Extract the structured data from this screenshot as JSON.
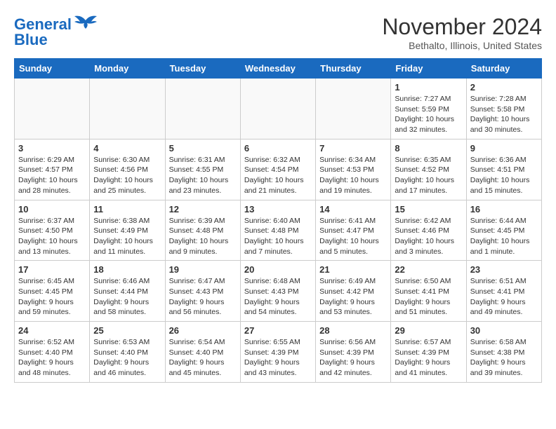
{
  "logo": {
    "line1": "General",
    "line2": "Blue"
  },
  "title": "November 2024",
  "location": "Bethalto, Illinois, United States",
  "days_of_week": [
    "Sunday",
    "Monday",
    "Tuesday",
    "Wednesday",
    "Thursday",
    "Friday",
    "Saturday"
  ],
  "weeks": [
    [
      {
        "day": "",
        "info": ""
      },
      {
        "day": "",
        "info": ""
      },
      {
        "day": "",
        "info": ""
      },
      {
        "day": "",
        "info": ""
      },
      {
        "day": "",
        "info": ""
      },
      {
        "day": "1",
        "info": "Sunrise: 7:27 AM\nSunset: 5:59 PM\nDaylight: 10 hours and 32 minutes."
      },
      {
        "day": "2",
        "info": "Sunrise: 7:28 AM\nSunset: 5:58 PM\nDaylight: 10 hours and 30 minutes."
      }
    ],
    [
      {
        "day": "3",
        "info": "Sunrise: 6:29 AM\nSunset: 4:57 PM\nDaylight: 10 hours and 28 minutes."
      },
      {
        "day": "4",
        "info": "Sunrise: 6:30 AM\nSunset: 4:56 PM\nDaylight: 10 hours and 25 minutes."
      },
      {
        "day": "5",
        "info": "Sunrise: 6:31 AM\nSunset: 4:55 PM\nDaylight: 10 hours and 23 minutes."
      },
      {
        "day": "6",
        "info": "Sunrise: 6:32 AM\nSunset: 4:54 PM\nDaylight: 10 hours and 21 minutes."
      },
      {
        "day": "7",
        "info": "Sunrise: 6:34 AM\nSunset: 4:53 PM\nDaylight: 10 hours and 19 minutes."
      },
      {
        "day": "8",
        "info": "Sunrise: 6:35 AM\nSunset: 4:52 PM\nDaylight: 10 hours and 17 minutes."
      },
      {
        "day": "9",
        "info": "Sunrise: 6:36 AM\nSunset: 4:51 PM\nDaylight: 10 hours and 15 minutes."
      }
    ],
    [
      {
        "day": "10",
        "info": "Sunrise: 6:37 AM\nSunset: 4:50 PM\nDaylight: 10 hours and 13 minutes."
      },
      {
        "day": "11",
        "info": "Sunrise: 6:38 AM\nSunset: 4:49 PM\nDaylight: 10 hours and 11 minutes."
      },
      {
        "day": "12",
        "info": "Sunrise: 6:39 AM\nSunset: 4:48 PM\nDaylight: 10 hours and 9 minutes."
      },
      {
        "day": "13",
        "info": "Sunrise: 6:40 AM\nSunset: 4:48 PM\nDaylight: 10 hours and 7 minutes."
      },
      {
        "day": "14",
        "info": "Sunrise: 6:41 AM\nSunset: 4:47 PM\nDaylight: 10 hours and 5 minutes."
      },
      {
        "day": "15",
        "info": "Sunrise: 6:42 AM\nSunset: 4:46 PM\nDaylight: 10 hours and 3 minutes."
      },
      {
        "day": "16",
        "info": "Sunrise: 6:44 AM\nSunset: 4:45 PM\nDaylight: 10 hours and 1 minute."
      }
    ],
    [
      {
        "day": "17",
        "info": "Sunrise: 6:45 AM\nSunset: 4:45 PM\nDaylight: 9 hours and 59 minutes."
      },
      {
        "day": "18",
        "info": "Sunrise: 6:46 AM\nSunset: 4:44 PM\nDaylight: 9 hours and 58 minutes."
      },
      {
        "day": "19",
        "info": "Sunrise: 6:47 AM\nSunset: 4:43 PM\nDaylight: 9 hours and 56 minutes."
      },
      {
        "day": "20",
        "info": "Sunrise: 6:48 AM\nSunset: 4:43 PM\nDaylight: 9 hours and 54 minutes."
      },
      {
        "day": "21",
        "info": "Sunrise: 6:49 AM\nSunset: 4:42 PM\nDaylight: 9 hours and 53 minutes."
      },
      {
        "day": "22",
        "info": "Sunrise: 6:50 AM\nSunset: 4:41 PM\nDaylight: 9 hours and 51 minutes."
      },
      {
        "day": "23",
        "info": "Sunrise: 6:51 AM\nSunset: 4:41 PM\nDaylight: 9 hours and 49 minutes."
      }
    ],
    [
      {
        "day": "24",
        "info": "Sunrise: 6:52 AM\nSunset: 4:40 PM\nDaylight: 9 hours and 48 minutes."
      },
      {
        "day": "25",
        "info": "Sunrise: 6:53 AM\nSunset: 4:40 PM\nDaylight: 9 hours and 46 minutes."
      },
      {
        "day": "26",
        "info": "Sunrise: 6:54 AM\nSunset: 4:40 PM\nDaylight: 9 hours and 45 minutes."
      },
      {
        "day": "27",
        "info": "Sunrise: 6:55 AM\nSunset: 4:39 PM\nDaylight: 9 hours and 43 minutes."
      },
      {
        "day": "28",
        "info": "Sunrise: 6:56 AM\nSunset: 4:39 PM\nDaylight: 9 hours and 42 minutes."
      },
      {
        "day": "29",
        "info": "Sunrise: 6:57 AM\nSunset: 4:39 PM\nDaylight: 9 hours and 41 minutes."
      },
      {
        "day": "30",
        "info": "Sunrise: 6:58 AM\nSunset: 4:38 PM\nDaylight: 9 hours and 39 minutes."
      }
    ]
  ]
}
